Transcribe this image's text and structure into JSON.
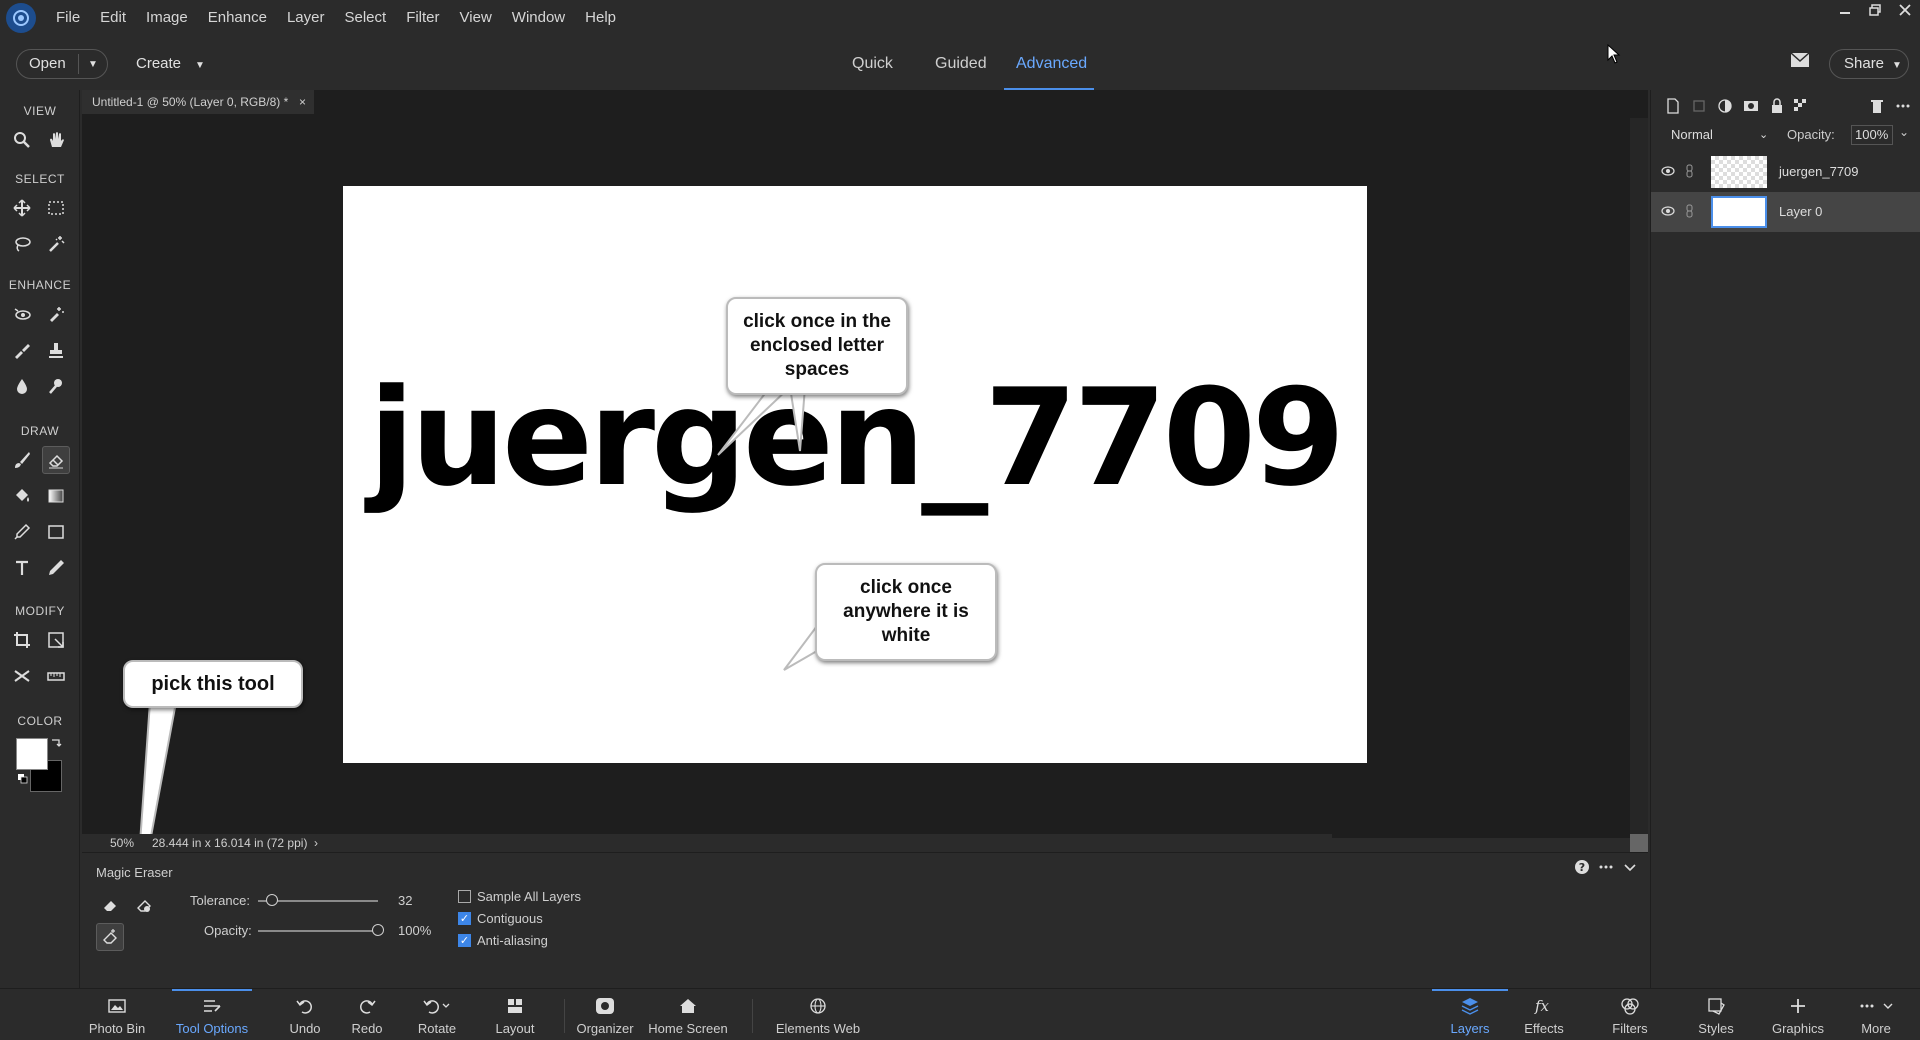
{
  "menubar": {
    "items": [
      "File",
      "Edit",
      "Image",
      "Enhance",
      "Layer",
      "Select",
      "Filter",
      "View",
      "Window",
      "Help"
    ]
  },
  "modebar": {
    "open_label": "Open",
    "create_label": "Create",
    "tabs": [
      "Quick",
      "Guided",
      "Advanced"
    ],
    "active_tab": "Advanced",
    "share_label": "Share"
  },
  "toolbar": {
    "sections": [
      "VIEW",
      "SELECT",
      "ENHANCE",
      "DRAW",
      "MODIFY",
      "COLOR"
    ]
  },
  "document": {
    "tab_title": "Untitled-1 @ 50% (Layer 0, RGB/8) *",
    "close_glyph": "×",
    "canvas_text": "juergen_7709",
    "zoom": "50%",
    "dimensions": "28.444 in x 16.014 in (72 ppi)"
  },
  "callouts": {
    "letters": "click once in the enclosed letter spaces",
    "white": "click once anywhere it is white",
    "tool": "pick this tool"
  },
  "layers": {
    "blend_mode": "Normal",
    "opacity_label": "Opacity:",
    "opacity_value": "100%",
    "rows": [
      {
        "name": "juergen_7709",
        "active": false
      },
      {
        "name": "Layer 0",
        "active": true
      }
    ]
  },
  "tool_options": {
    "title": "Magic Eraser",
    "tolerance_label": "Tolerance:",
    "tolerance_value": "32",
    "tolerance_fraction": 0.12,
    "opacity_label": "Opacity:",
    "opacity_value": "100%",
    "opacity_fraction": 1.0,
    "checkboxes": [
      {
        "label": "Sample All Layers",
        "checked": false
      },
      {
        "label": "Contiguous",
        "checked": true
      },
      {
        "label": "Anti-aliasing",
        "checked": true
      }
    ]
  },
  "taskbar": {
    "left": [
      "Photo Bin",
      "Tool Options",
      "Undo",
      "Redo",
      "Rotate",
      "Layout",
      "Organizer",
      "Home Screen",
      "Elements Web"
    ],
    "right": [
      "Layers",
      "Effects",
      "Filters",
      "Styles",
      "Graphics",
      "More"
    ],
    "active_left": "Tool Options",
    "active_right": "Layers"
  },
  "colors": {
    "accent": "#4b8fea",
    "foreground_color": "#ffffff",
    "background_color": "#000000"
  }
}
